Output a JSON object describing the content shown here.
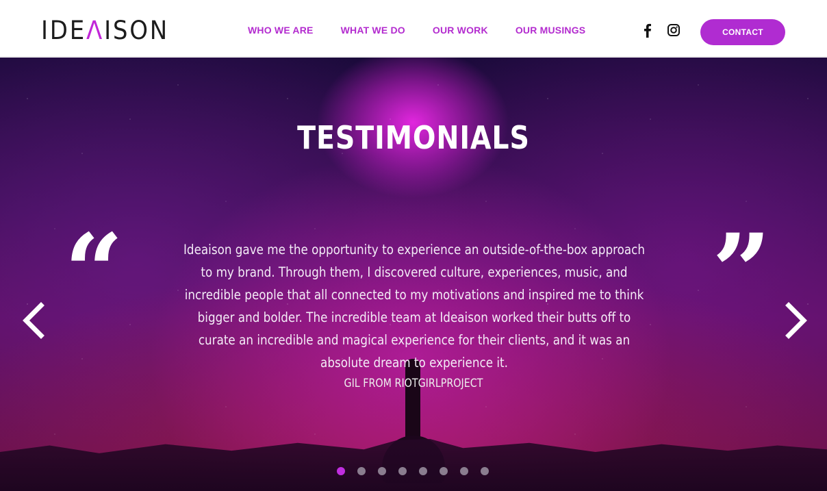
{
  "header": {
    "logo": {
      "text_before": "IDE",
      "accent": "Λ",
      "text_after": "ISON"
    },
    "nav": [
      {
        "label": "WHO WE ARE"
      },
      {
        "label": "WHAT WE DO"
      },
      {
        "label": "OUR WORK"
      },
      {
        "label": "OUR MUSINGS"
      }
    ],
    "social_icons": [
      "facebook-icon",
      "instagram-icon"
    ],
    "contact_label": "CONTACT"
  },
  "hero": {
    "title": "TESTIMONIALS",
    "quote_open": "“",
    "quote_close": "”",
    "quote": "Ideaison gave me the opportunity to experience an outside-of-the-box approach to my brand. Through them, I discovered culture, experiences, music, and incredible people that all connected to my motivations and inspired me to think bigger and bolder. The incredible team at Ideaison worked their butts off to curate an incredible and magical experience for their clients, and it was an absolute dream to experience it.",
    "author": "GIL FROM RIOTGIRLPROJECT",
    "arrow_left_icon": "chevron-left-icon",
    "arrow_right_icon": "chevron-right-icon",
    "slide_count": 8,
    "active_slide": 1
  },
  "colors": {
    "brand_purple": "#b02cd1",
    "active_dot": "#c12ee0",
    "inactive_dot": "#8a7d8f"
  }
}
